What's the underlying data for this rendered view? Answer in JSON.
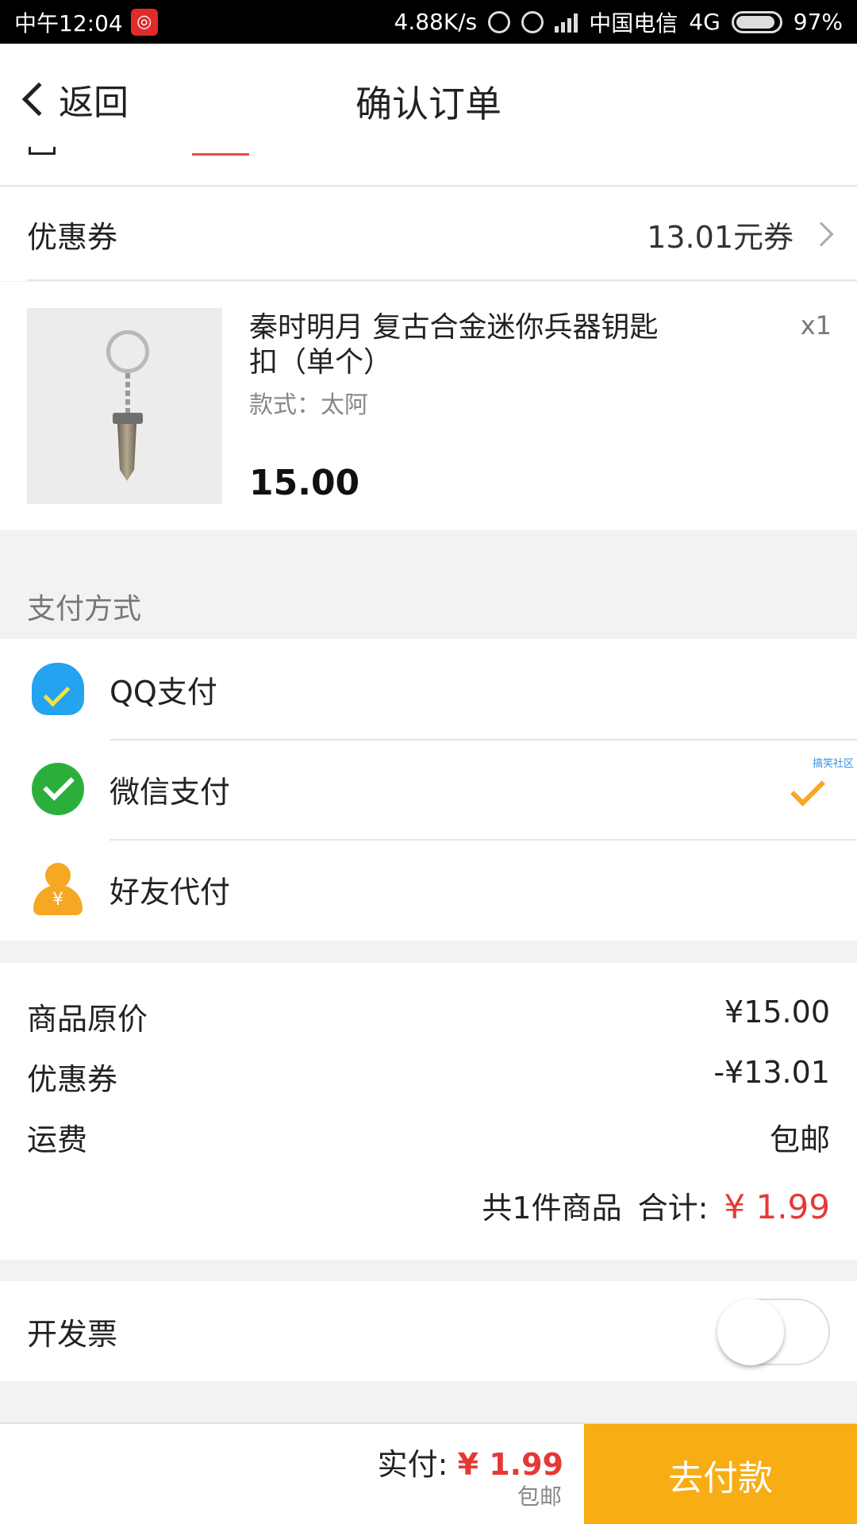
{
  "status_bar": {
    "time": "中午12:04",
    "net_speed": "4.88K/s",
    "carrier": "中国电信",
    "network": "4G",
    "battery": "97%"
  },
  "nav": {
    "back_label": "返回",
    "title": "确认订单"
  },
  "coupon": {
    "label": "优惠券",
    "value": "13.01元券"
  },
  "product": {
    "title": "秦时明月 复古合金迷你兵器钥匙扣（单个）",
    "quantity": "x1",
    "spec": "款式：太阿",
    "price": "15.00"
  },
  "payment": {
    "header": "支付方式",
    "methods": [
      {
        "label": "QQ支付",
        "icon": "qq-icon",
        "selected": false
      },
      {
        "label": "微信支付",
        "icon": "wechat-icon",
        "selected": true
      },
      {
        "label": "好友代付",
        "icon": "friend-pay-icon",
        "selected": false
      }
    ],
    "watermark": "搞笑社区"
  },
  "summary": {
    "rows": [
      {
        "label": "商品原价",
        "value": "¥15.00"
      },
      {
        "label": "优惠券",
        "value": "-¥13.01"
      },
      {
        "label": "运费",
        "value": "包邮"
      }
    ],
    "count_text": "共1件商品",
    "total_label": "合计:",
    "total_value": "¥ 1.99"
  },
  "invoice": {
    "label": "开发票",
    "enabled": false
  },
  "bottom": {
    "pay_label": "实付:",
    "pay_amount": "¥ 1.99",
    "shipping": "包邮",
    "button": "去付款"
  },
  "colors": {
    "accent": "#f7ad13",
    "price_red": "#e53935",
    "check_orange": "#f5a623"
  }
}
